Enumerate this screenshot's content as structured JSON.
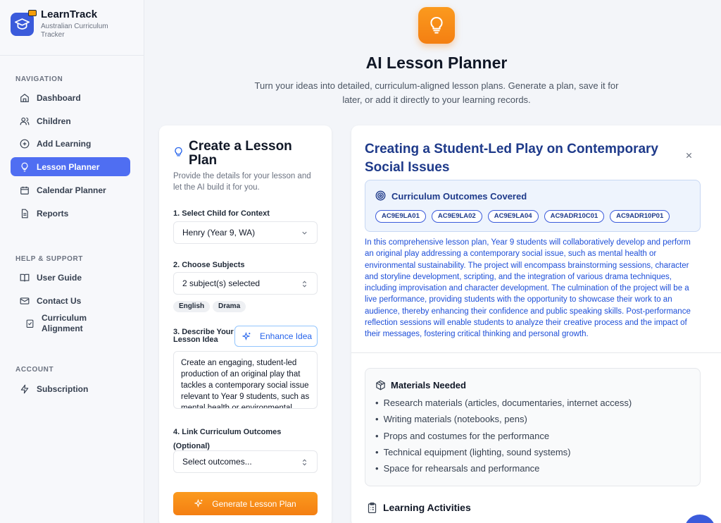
{
  "brand": {
    "name": "LearnTrack",
    "subtitle": "Australian Curriculum Tracker"
  },
  "sidebar": {
    "nav_title": "NAVIGATION",
    "nav": [
      {
        "label": "Dashboard",
        "icon": "home-icon"
      },
      {
        "label": "Children",
        "icon": "users-icon"
      },
      {
        "label": "Add Learning",
        "icon": "plus-circle-icon"
      },
      {
        "label": "Lesson Planner",
        "icon": "lightbulb-icon",
        "active": true
      },
      {
        "label": "Calendar Planner",
        "icon": "calendar-icon"
      },
      {
        "label": "Reports",
        "icon": "file-icon"
      }
    ],
    "help_title": "HELP & SUPPORT",
    "help": [
      {
        "label": "User Guide",
        "icon": "book-icon"
      },
      {
        "label": "Contact Us",
        "icon": "mail-icon"
      },
      {
        "label": "Curriculum Alignment",
        "icon": "checklist-icon"
      }
    ],
    "account_title": "ACCOUNT",
    "account": [
      {
        "label": "Subscription",
        "icon": "zap-icon"
      }
    ]
  },
  "header": {
    "title": "AI Lesson Planner",
    "subtitle": "Turn your ideas into detailed, curriculum-aligned lesson plans. Generate a plan, save it for later, or add it directly to your learning records."
  },
  "form": {
    "title": "Create a Lesson Plan",
    "description": "Provide the details for your lesson and let the AI build it for you.",
    "child_label": "1. Select Child for Context",
    "child_value": "Henry (Year 9, WA)",
    "subjects_label": "2. Choose Subjects",
    "subjects_value": "2 subject(s) selected",
    "subject_chips": [
      "English",
      "Drama"
    ],
    "idea_label": "3. Describe Your Lesson Idea",
    "enhance_label": "Enhance Idea",
    "idea_text": "Create an engaging, student-led production of an original play that tackles a contemporary social issue relevant to Year 9 students, such as mental health or environmental",
    "outcomes_label": "4. Link Curriculum Outcomes (Optional)",
    "outcomes_value": "Select outcomes...",
    "generate_label": "Generate Lesson Plan"
  },
  "plan": {
    "title": "Creating a Student-Led Play on Contemporary Social Issues",
    "outcomes_title": "Curriculum Outcomes Covered",
    "codes": [
      "AC9E9LA01",
      "AC9E9LA02",
      "AC9E9LA04",
      "AC9ADR10C01",
      "AC9ADR10P01"
    ],
    "summary": "In this comprehensive lesson plan, Year 9 students will collaboratively develop and perform an original play addressing a contemporary social issue, such as mental health or environmental sustainability. The project will encompass brainstorming sessions, character and storyline development, scripting, and the integration of various drama techniques, including improvisation and character development. The culmination of the project will be a live performance, providing students with the opportunity to showcase their work to an audience, thereby enhancing their confidence and public speaking skills. Post-performance reflection sessions will enable students to analyze their creative process and the impact of their messages, fostering critical thinking and personal growth.",
    "materials_title": "Materials Needed",
    "materials": [
      "Research materials (articles, documentaries, internet access)",
      "Writing materials (notebooks, pens)",
      "Props and costumes for the performance",
      "Technical equipment (lighting, sound systems)",
      "Space for rehearsals and performance"
    ],
    "activities_title": "Learning Activities"
  },
  "colors": {
    "accent": "#4f6ef2",
    "orange": "#f47f12",
    "plan_title": "#1e3a8a",
    "summary_text": "#1d4ed8"
  }
}
